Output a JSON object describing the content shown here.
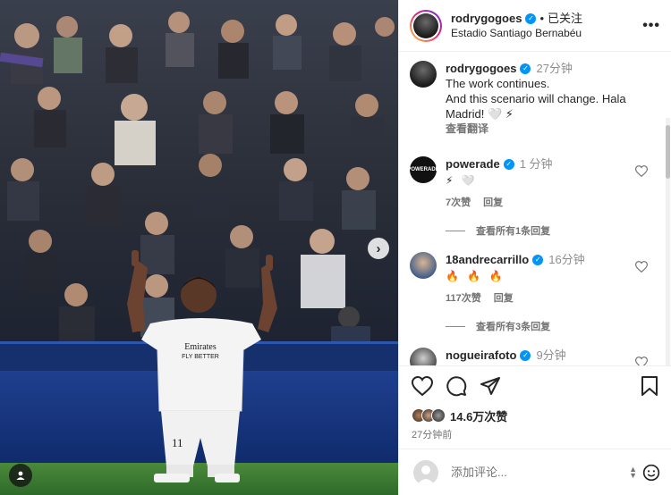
{
  "header": {
    "username": "rodrygogoes",
    "separator": "•",
    "follow_label": "已关注",
    "location": "Estadio Santiago Bernabéu"
  },
  "media": {
    "jersey_text": "Emirates FLY BETTER",
    "jersey_number": "11",
    "next_icon": "chevron-right-icon",
    "tag_icon": "person-tag-icon"
  },
  "caption": {
    "username": "rodrygogoes",
    "time": "27分钟",
    "line1": "The work continues.",
    "line2": "And this scenario will change. Hala Madrid! 🤍 ⚡",
    "translate": "查看翻译"
  },
  "comments": [
    {
      "username": "powerade",
      "time": "1 分钟",
      "text": "⚡ 🤍",
      "likes": "7次赞",
      "reply": "回复",
      "view_replies": "查看所有1条回复"
    },
    {
      "username": "18andrecarrillo",
      "time": "16分钟",
      "text": "🔥 🔥 🔥",
      "likes": "117次赞",
      "reply": "回复",
      "view_replies": "查看所有3条回复"
    },
    {
      "username": "nogueirafoto",
      "time": "9分钟",
      "text": "💪 ⚡"
    }
  ],
  "actions": {
    "like_icon": "heart-icon",
    "comment_icon": "comment-icon",
    "share_icon": "send-icon",
    "save_icon": "bookmark-icon"
  },
  "likes": {
    "count": "14.6万次赞",
    "time_ago": "27分钟前"
  },
  "add_comment": {
    "placeholder": "添加评论..."
  },
  "colors": {
    "verified": "#0095f6",
    "secondary_text": "#737373",
    "border": "#efefef"
  }
}
